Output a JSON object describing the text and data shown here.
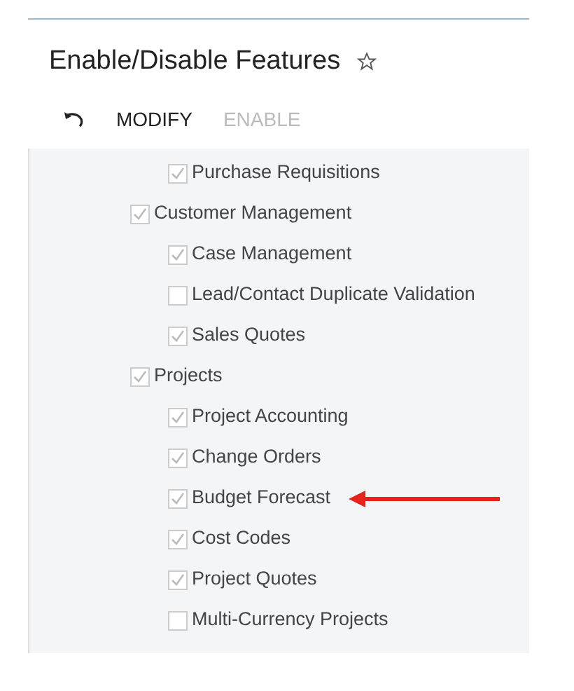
{
  "page": {
    "title": "Enable/Disable Features",
    "favorite": false
  },
  "toolbar": [
    {
      "kind": "undo",
      "disabled": false
    },
    {
      "kind": "text",
      "label": "MODIFY",
      "disabled": false
    },
    {
      "kind": "text",
      "label": "ENABLE",
      "disabled": true
    }
  ],
  "tree": [
    {
      "children": [
        {
          "label": "Purchase Requisitions",
          "checked": true
        }
      ]
    },
    {
      "label": "Customer Management",
      "checked": true,
      "children": [
        {
          "label": "Case Management",
          "checked": true
        },
        {
          "label": "Lead/Contact Duplicate Validation",
          "checked": false
        },
        {
          "label": "Sales Quotes",
          "checked": true
        }
      ]
    },
    {
      "label": "Projects",
      "checked": true,
      "children": [
        {
          "label": "Project Accounting",
          "checked": true
        },
        {
          "label": "Change Orders",
          "checked": true
        },
        {
          "label": "Budget Forecast",
          "checked": true,
          "highlighted": true
        },
        {
          "label": "Cost Codes",
          "checked": true
        },
        {
          "label": "Project Quotes",
          "checked": true
        },
        {
          "label": "Multi-Currency Projects",
          "checked": false
        }
      ]
    }
  ]
}
